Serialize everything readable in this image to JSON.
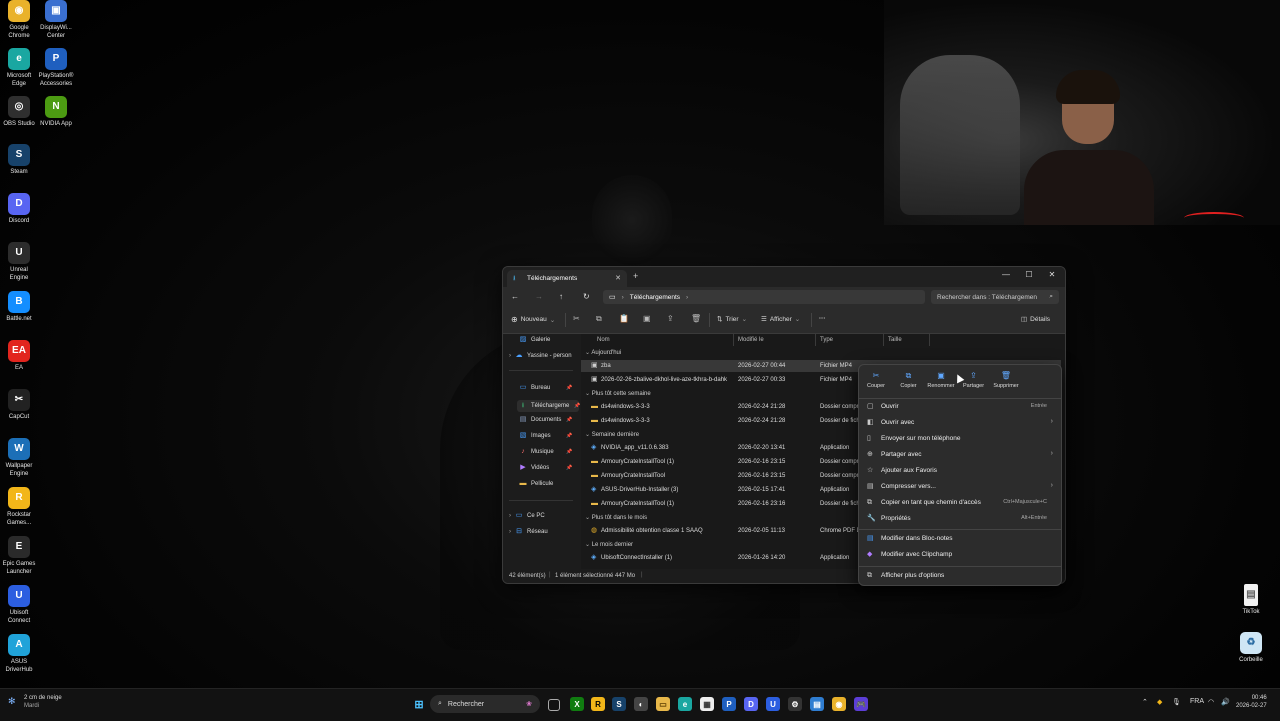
{
  "desktop": {
    "left_icons": [
      {
        "label": "Google Chrome",
        "icon": "chrome-icon",
        "color": "#e9b22b"
      },
      {
        "label": "DisplayWi... Center",
        "icon": "display-center-icon",
        "color": "#3a6fd0"
      },
      {
        "label": "Microsoft Edge",
        "icon": "edge-icon",
        "color": "#1aa7a1"
      },
      {
        "label": "PlayStation® Accessories",
        "icon": "playstation-icon",
        "color": "#1f5fbf"
      },
      {
        "label": "OBS Studio",
        "icon": "obs-icon",
        "color": "#2f2f2f"
      },
      {
        "label": "NVIDIA App",
        "icon": "nvidia-icon",
        "color": "#4c9b12"
      },
      {
        "label": "Steam",
        "icon": "steam-icon",
        "color": "#17426a"
      },
      {
        "label": "Discord",
        "icon": "discord-icon",
        "color": "#5865f2"
      },
      {
        "label": "Unreal Engine",
        "icon": "unreal-icon",
        "color": "#2c2c2c"
      },
      {
        "label": "Battle.net",
        "icon": "battlenet-icon",
        "color": "#148eff"
      },
      {
        "label": "EA",
        "icon": "ea-icon",
        "color": "#e2251e"
      },
      {
        "label": "CapCut",
        "icon": "capcut-icon",
        "color": "#222222"
      },
      {
        "label": "Wallpaper Engine",
        "icon": "wallpaper-engine-icon",
        "color": "#1c6fb7"
      },
      {
        "label": "Rockstar Games...",
        "icon": "rockstar-icon",
        "color": "#f2b619"
      },
      {
        "label": "Epic Games Launcher",
        "icon": "epic-icon",
        "color": "#2a2a2a"
      },
      {
        "label": "Ubisoft Connect",
        "icon": "ubisoft-icon",
        "color": "#2c5ee0"
      },
      {
        "label": "ASUS DriverHub",
        "icon": "asus-icon",
        "color": "#20a3d9"
      }
    ],
    "right_icons": [
      {
        "label": "TikTok",
        "icon": "file-icon"
      },
      {
        "label": "Corbeille",
        "icon": "recycle-bin-icon"
      }
    ]
  },
  "explorer": {
    "tab_title": "Téléchargements",
    "breadcrumb": "Téléchargements",
    "search_placeholder": "Rechercher dans : Téléchargemen",
    "toolbar": {
      "new": "Nouveau",
      "sort": "Trier",
      "view": "Afficher",
      "more": "···",
      "details": "Détails"
    },
    "nav": [
      {
        "label": "Galerie",
        "icon": "gallery-icon"
      },
      {
        "label": "Yassine - person",
        "icon": "onedrive-icon"
      },
      {
        "label": "Bureau",
        "icon": "desktop-folder-icon"
      },
      {
        "label": "Téléchargeme",
        "icon": "download-icon"
      },
      {
        "label": "Documents",
        "icon": "documents-icon"
      },
      {
        "label": "Images",
        "icon": "images-icon"
      },
      {
        "label": "Musique",
        "icon": "music-icon"
      },
      {
        "label": "Vidéos",
        "icon": "videos-icon"
      },
      {
        "label": "Pellicule",
        "icon": "folder-icon"
      },
      {
        "label": "Ce PC",
        "icon": "pc-icon"
      },
      {
        "label": "Réseau",
        "icon": "network-icon"
      }
    ],
    "columns": {
      "name": "Nom",
      "modified": "Modifié le",
      "type": "Type",
      "size": "Taille"
    },
    "groups": {
      "today": "Aujourd'hui",
      "this_week": "Plus tôt cette semaine",
      "last_week": "Semaine dernière",
      "this_month": "Plus tôt dans le mois",
      "last_month": "Le mois dernier"
    },
    "files": [
      {
        "name": "zba",
        "date": "2026-02-27 00:44",
        "type": "Fichier MP4",
        "icon": "video-file-icon"
      },
      {
        "name": "2026-02-26-zbalive-dkhol-live-aze-tkhra-b-dahk",
        "date": "2026-02-27 00:33",
        "type": "Fichier MP4",
        "icon": "video-file-icon"
      },
      {
        "name": "ds4windows-3-3-3",
        "date": "2026-02-24 21:28",
        "type": "Dossier compre",
        "icon": "zip-folder-icon"
      },
      {
        "name": "ds4windows-3-3-3",
        "date": "2026-02-24 21:28",
        "type": "Dossier de fich",
        "icon": "folder-icon"
      },
      {
        "name": "NVIDIA_app_v11.0.6.383",
        "date": "2026-02-20 13:41",
        "type": "Application",
        "icon": "app-icon"
      },
      {
        "name": "ArmouryCrateInstallTool (1)",
        "date": "2026-02-16 23:15",
        "type": "Dossier compre",
        "icon": "zip-folder-icon"
      },
      {
        "name": "ArmouryCrateInstallTool",
        "date": "2026-02-16 23:15",
        "type": "Dossier compre",
        "icon": "zip-folder-icon"
      },
      {
        "name": "ASUS-DriverHub-Installer (3)",
        "date": "2026-02-15 17:41",
        "type": "Application",
        "icon": "app-icon"
      },
      {
        "name": "ArmouryCrateInstallTool (1)",
        "date": "2026-02-16 23:16",
        "type": "Dossier de fich",
        "icon": "folder-icon"
      },
      {
        "name": "Admissibilité obtention classe 1 SAAQ",
        "date": "2026-02-05 11:13",
        "type": "Chrome PDF Do",
        "icon": "pdf-icon"
      },
      {
        "name": "UbisoftConnectInstaller (1)",
        "date": "2026-01-26 14:20",
        "type": "Application",
        "icon": "app-icon"
      }
    ],
    "status": {
      "count": "42 élément(s)",
      "selected": "1 élément sélectionné  447 Mo"
    }
  },
  "context_menu": {
    "quick_actions": [
      {
        "label": "Couper",
        "icon": "scissors-icon"
      },
      {
        "label": "Copier",
        "icon": "copy-icon"
      },
      {
        "label": "Renommer",
        "icon": "rename-icon"
      },
      {
        "label": "Partager",
        "icon": "share-icon"
      },
      {
        "label": "Supprimer",
        "icon": "trash-icon"
      }
    ],
    "items": [
      {
        "label": "Ouvrir",
        "shortcut": "Entrée",
        "icon": "open-icon",
        "arrow": false
      },
      {
        "label": "Ouvrir avec",
        "shortcut": "",
        "icon": "open-with-icon",
        "arrow": true
      },
      {
        "label": "Envoyer sur mon téléphone",
        "shortcut": "",
        "icon": "phone-icon",
        "arrow": false
      },
      {
        "label": "Partager avec",
        "shortcut": "",
        "icon": "share-with-icon",
        "arrow": true
      },
      {
        "label": "Ajouter aux Favoris",
        "shortcut": "",
        "icon": "star-icon",
        "arrow": false
      },
      {
        "label": "Compresser vers...",
        "shortcut": "",
        "icon": "compress-icon",
        "arrow": true
      },
      {
        "label": "Copier en tant que chemin d'accès",
        "shortcut": "Ctrl+Majuscule+C",
        "icon": "path-icon",
        "arrow": false
      },
      {
        "label": "Propriétés",
        "shortcut": "Alt+Entrée",
        "icon": "properties-icon",
        "arrow": false
      }
    ],
    "extra_items": [
      {
        "label": "Modifier dans Bloc-notes",
        "icon": "notepad-icon"
      },
      {
        "label": "Modifier avec Clipchamp",
        "icon": "clipchamp-icon"
      }
    ],
    "more": {
      "label": "Afficher plus d'options",
      "icon": "more-options-icon"
    }
  },
  "taskbar": {
    "weather_line1": "2 cm de neige",
    "weather_line2": "Mardi",
    "search": "Rechercher",
    "language": "FRA",
    "time": "00:46",
    "date": "2026-02-27"
  }
}
